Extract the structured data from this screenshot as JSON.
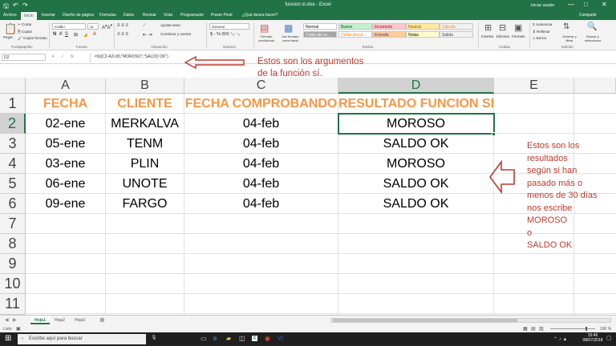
{
  "window": {
    "title": "funcion si.xlsx - Excel",
    "sign_in": "Iniciar sesión",
    "share": "Compartir",
    "min": "—",
    "max": "□",
    "close": "✕"
  },
  "tabs": [
    "Archivo",
    "Inicio",
    "Insertar",
    "Diseño de página",
    "Fórmulas",
    "Datos",
    "Revisar",
    "Vista",
    "Programador",
    "Power Pivot",
    "¿Qué desea hacer?"
  ],
  "ribbon": {
    "paste": "Pegar",
    "cut": "Cortar",
    "copy": "Copiar",
    "format_painter": "Copiar formato",
    "clipboard": "Portapapeles",
    "font_name": "Calibri",
    "font_size": "11",
    "font": "Fuente",
    "wrap": "Ajustar texto",
    "merge": "Combinar y centrar",
    "alignment": "Alineación",
    "number_format": "General",
    "number": "Número",
    "cond_format": "Formato condicional",
    "format_table": "Dar formato como tabla",
    "styles_label": "Estilos",
    "styles": [
      "Normal",
      "Bueno",
      "Incorrecto",
      "Neutral",
      "Cálculo",
      "Celda de co...",
      "Celda vincul...",
      "Entrada",
      "Notas",
      "Salida"
    ],
    "insert": "Insertar",
    "delete": "Eliminar",
    "format": "Formato",
    "cells": "Celdas",
    "autosum": "Autosuma",
    "fill": "Rellenar",
    "clear": "Borrar",
    "sort": "Ordenar y filtrar",
    "find": "Buscar y seleccionar",
    "editing": "Edición"
  },
  "formula_bar": {
    "name_box": "D2",
    "fx": "fx",
    "formula": "=SI(C2-A2>30,\"MOROSO\",\"SALDO OK\")"
  },
  "columns": [
    "A",
    "B",
    "C",
    "D",
    "E"
  ],
  "rows": [
    "1",
    "2",
    "3",
    "4",
    "5",
    "6",
    "7",
    "8",
    "9",
    "10",
    "11"
  ],
  "table": {
    "headers": [
      "FECHA",
      "CLIENTE",
      "FECHA COMPROBANDO",
      "RESULTADO FUNCION SI"
    ],
    "data": [
      [
        "02-ene",
        "MERKALVA",
        "04-feb",
        "MOROSO"
      ],
      [
        "05-ene",
        "TENM",
        "04-feb",
        "SALDO OK"
      ],
      [
        "03-ene",
        "PLIN",
        "04-feb",
        "MOROSO"
      ],
      [
        "06-ene",
        "UNOTE",
        "04-feb",
        "SALDO OK"
      ],
      [
        "09-ene",
        "FARGO",
        "04-feb",
        "SALDO OK"
      ]
    ]
  },
  "annotations": {
    "args": [
      "Estos son los argumentos",
      "de la función sí."
    ],
    "results": [
      "Estos son los",
      "resultados",
      "según si han",
      "pasado más o",
      "menos de 30 días",
      "nos escribe",
      "MOROSO",
      "o",
      "SALDO OK"
    ]
  },
  "sheets": [
    "Hoja1",
    "Hoja2",
    "Hoja3"
  ],
  "status": {
    "mode": "Listo",
    "zoom": "190 %"
  },
  "taskbar": {
    "search_placeholder": "Escribe aquí para buscar",
    "time": "15:46",
    "date": "08/07/2018"
  },
  "colors": {
    "excel_green": "#217346",
    "header_orange": "#f79646",
    "annotation_red": "#c0392b"
  }
}
